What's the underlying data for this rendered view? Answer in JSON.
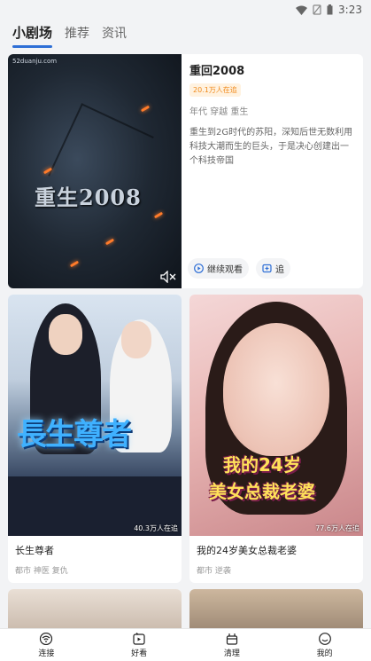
{
  "status": {
    "time": "3:23"
  },
  "tabs": [
    {
      "label": "小剧场"
    },
    {
      "label": "推荐"
    },
    {
      "label": "资讯"
    }
  ],
  "featured": {
    "watermark": "52duanju.com",
    "poster_text": "重生2008",
    "title": "重回2008",
    "badge": "20.1万人在追",
    "tags": "年代 穿越 重生",
    "desc": "重生到2G时代的苏阳，深知后世无数利用科技大潮而生的巨头，于是决心创建出一个科技帝国",
    "continue_label": "继续观看",
    "follow_label": "追"
  },
  "cards": [
    {
      "title": "长生尊者",
      "tags": "都市 神医 复仇",
      "views": "40.3万人在追",
      "poster_text": "長生尊者"
    },
    {
      "title": "我的24岁美女总裁老婆",
      "tags": "都市 逆袭",
      "views": "77.6万人在追",
      "poster_line1": "我的24岁",
      "poster_line2": "美女总裁老婆"
    }
  ],
  "nav": [
    {
      "label": "连接",
      "icon": "wifi-icon"
    },
    {
      "label": "好看",
      "icon": "video-icon"
    },
    {
      "label": "清理",
      "icon": "clean-icon"
    },
    {
      "label": "我的",
      "icon": "smile-icon"
    }
  ],
  "colors": {
    "accent": "#2f6fd6",
    "badge": "#f08a1c"
  }
}
